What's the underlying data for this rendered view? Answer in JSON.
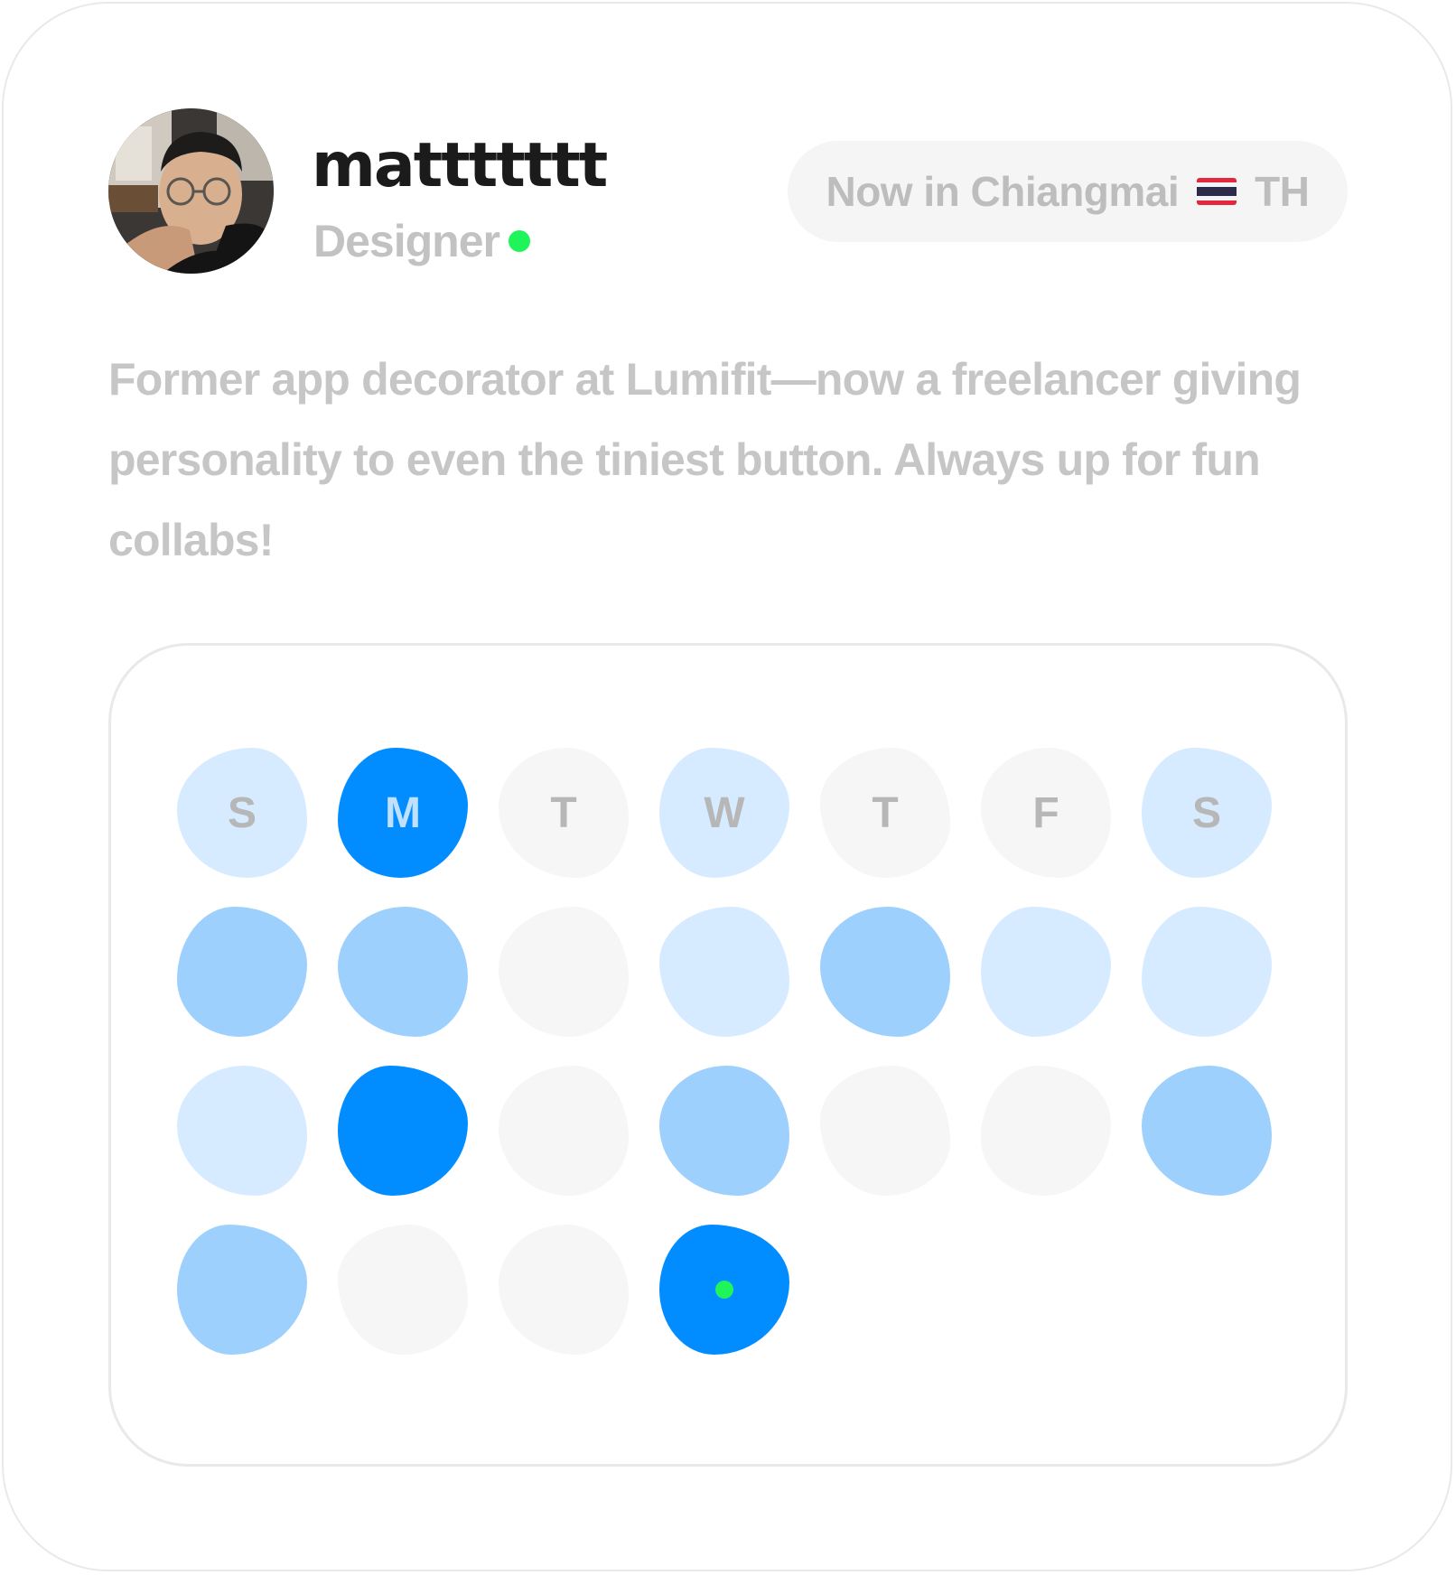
{
  "profile": {
    "avatar_icon": "user-photo-avatar",
    "username": "mattttttt",
    "role": "Designer",
    "status_color": "#1ff55a",
    "location_text": "Now in Chiangmai",
    "country_flag_icon": "thailand-flag-icon",
    "country_code": "TH"
  },
  "bio": "Former app decorator at Lumifit—now a freelancer giving personality to even the tiniest button. Always up for fun collabs!",
  "calendar": {
    "palette": {
      "level_1": "#f6f6f6",
      "level_2": "#d6ebff",
      "level_3": "#9dd0fc",
      "level_4": "#018dff"
    },
    "rows": [
      [
        {
          "label": "S",
          "level": 2,
          "shape": "s1"
        },
        {
          "label": "M",
          "level": 4,
          "shape": "s2"
        },
        {
          "label": "T",
          "level": 1,
          "shape": "s3"
        },
        {
          "label": "W",
          "level": 2,
          "shape": "s4"
        },
        {
          "label": "T",
          "level": 1,
          "shape": "s5"
        },
        {
          "label": "F",
          "level": 1,
          "shape": "s3"
        },
        {
          "label": "S",
          "level": 2,
          "shape": "s4"
        }
      ],
      [
        {
          "label": "",
          "level": 3,
          "shape": "s2"
        },
        {
          "label": "",
          "level": 3,
          "shape": "s3"
        },
        {
          "label": "",
          "level": 1,
          "shape": "s1"
        },
        {
          "label": "",
          "level": 2,
          "shape": "s5"
        },
        {
          "label": "",
          "level": 3,
          "shape": "s3"
        },
        {
          "label": "",
          "level": 2,
          "shape": "s4"
        },
        {
          "label": "",
          "level": 2,
          "shape": "s2"
        }
      ],
      [
        {
          "label": "",
          "level": 2,
          "shape": "s3"
        },
        {
          "label": "",
          "level": 4,
          "shape": "s4"
        },
        {
          "label": "",
          "level": 1,
          "shape": "s1"
        },
        {
          "label": "",
          "level": 3,
          "shape": "s3"
        },
        {
          "label": "",
          "level": 1,
          "shape": "s5"
        },
        {
          "label": "",
          "level": 1,
          "shape": "s2"
        },
        {
          "label": "",
          "level": 3,
          "shape": "s3"
        }
      ],
      [
        {
          "label": "",
          "level": 3,
          "shape": "s4"
        },
        {
          "label": "",
          "level": 1,
          "shape": "s5"
        },
        {
          "label": "",
          "level": 1,
          "shape": "s3"
        },
        {
          "label": "",
          "level": 4,
          "shape": "s4",
          "today": true
        }
      ]
    ]
  }
}
